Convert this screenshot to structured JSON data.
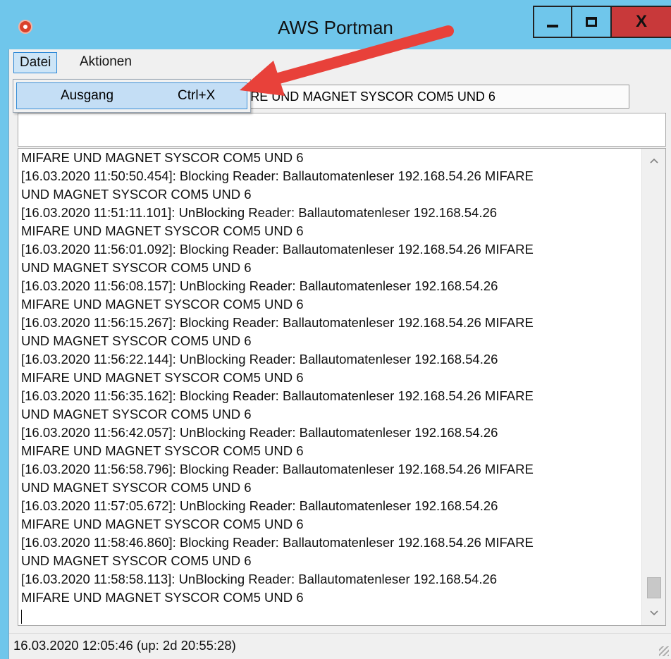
{
  "window": {
    "title": "AWS Portman",
    "minimize_icon": "minimize-icon",
    "maximize_icon": "maximize-icon",
    "close_glyph": "X"
  },
  "menubar": {
    "items": [
      "Datei",
      "Aktionen"
    ]
  },
  "dropdown": {
    "items": [
      {
        "label": "Ausgang",
        "shortcut": "Ctrl+X"
      }
    ]
  },
  "tab": {
    "label": "Ballautomatenleser 192.168.54.26 MIFARE UND MAGNET SYSCOR COM5 UND 6"
  },
  "log": {
    "lines": [
      "MIFARE UND MAGNET SYSCOR COM5 UND 6",
      "[16.03.2020 11:50:50.454]: Blocking Reader: Ballautomatenleser 192.168.54.26 MIFARE",
      "UND MAGNET SYSCOR COM5 UND 6",
      "[16.03.2020 11:51:11.101]: UnBlocking Reader: Ballautomatenleser 192.168.54.26",
      "MIFARE UND MAGNET SYSCOR COM5 UND 6",
      "[16.03.2020 11:56:01.092]: Blocking Reader: Ballautomatenleser 192.168.54.26 MIFARE",
      "UND MAGNET SYSCOR COM5 UND 6",
      "[16.03.2020 11:56:08.157]: UnBlocking Reader: Ballautomatenleser 192.168.54.26",
      "MIFARE UND MAGNET SYSCOR COM5 UND 6",
      "[16.03.2020 11:56:15.267]: Blocking Reader: Ballautomatenleser 192.168.54.26 MIFARE",
      "UND MAGNET SYSCOR COM5 UND 6",
      "[16.03.2020 11:56:22.144]: UnBlocking Reader: Ballautomatenleser 192.168.54.26",
      "MIFARE UND MAGNET SYSCOR COM5 UND 6",
      "[16.03.2020 11:56:35.162]: Blocking Reader: Ballautomatenleser 192.168.54.26 MIFARE",
      "UND MAGNET SYSCOR COM5 UND 6",
      "[16.03.2020 11:56:42.057]: UnBlocking Reader: Ballautomatenleser 192.168.54.26",
      "MIFARE UND MAGNET SYSCOR COM5 UND 6",
      "[16.03.2020 11:56:58.796]: Blocking Reader: Ballautomatenleser 192.168.54.26 MIFARE",
      "UND MAGNET SYSCOR COM5 UND 6",
      "[16.03.2020 11:57:05.672]: UnBlocking Reader: Ballautomatenleser 192.168.54.26",
      "MIFARE UND MAGNET SYSCOR COM5 UND 6",
      "[16.03.2020 11:58:46.860]: Blocking Reader: Ballautomatenleser 192.168.54.26 MIFARE",
      "UND MAGNET SYSCOR COM5 UND 6",
      "[16.03.2020 11:58:58.113]: UnBlocking Reader: Ballautomatenleser 192.168.54.26",
      "MIFARE UND MAGNET SYSCOR COM5 UND 6"
    ]
  },
  "statusbar": {
    "text": "16.03.2020 12:05:46 (up: 2d 20:55:28)"
  },
  "colors": {
    "titlebar": "#6fc6eb",
    "close_button": "#c8393a",
    "annotation_arrow": "#e8413a",
    "menu_highlight": "#c4def5"
  },
  "icons": {
    "app": "app-icon",
    "scroll_up": "chevron-up-icon",
    "scroll_down": "chevron-down-icon",
    "annotation": "arrow-annotation-icon"
  }
}
